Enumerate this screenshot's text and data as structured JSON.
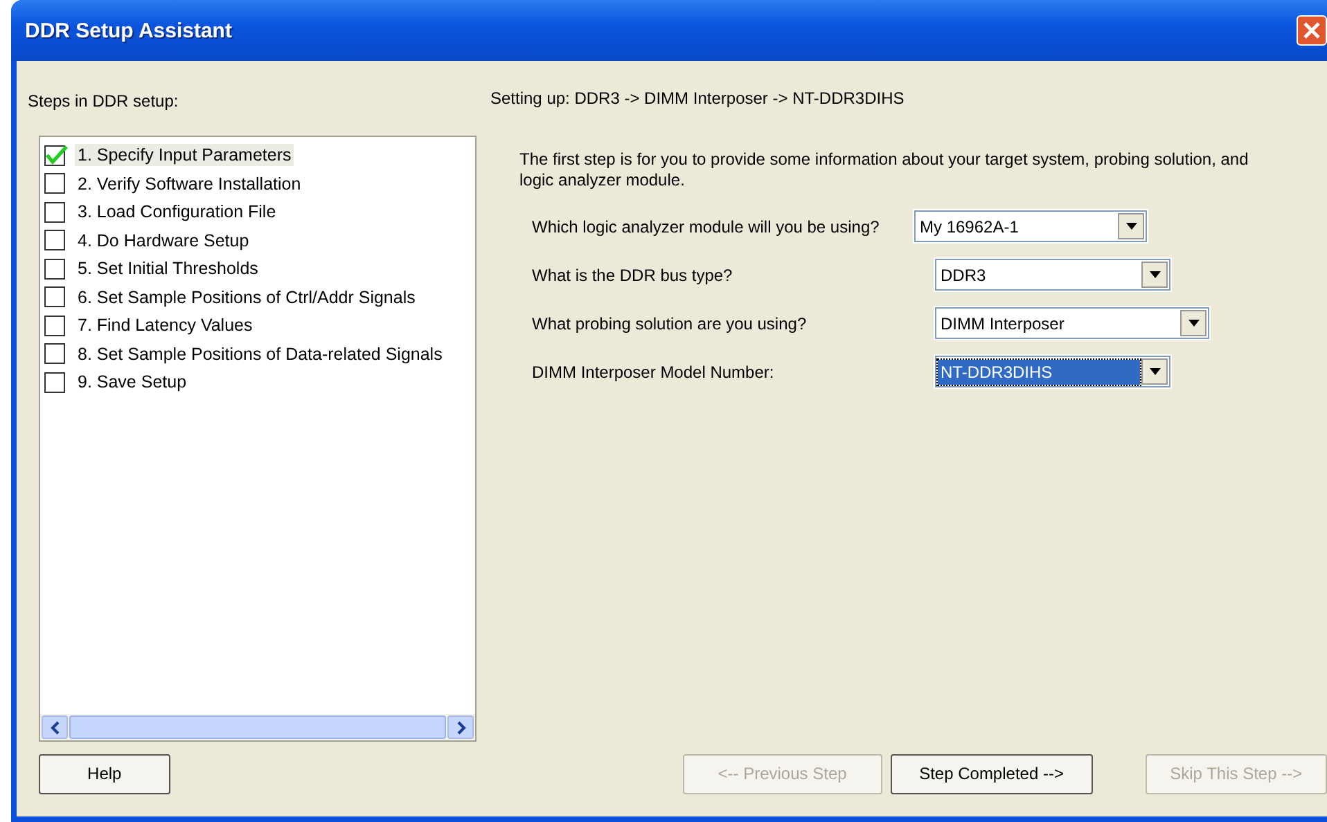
{
  "window": {
    "title": "DDR Setup Assistant"
  },
  "steps_label": "Steps in DDR setup:",
  "steps": [
    {
      "label": "1. Specify Input Parameters",
      "checked": true,
      "selected": true
    },
    {
      "label": "2. Verify Software Installation",
      "checked": false,
      "selected": false
    },
    {
      "label": "3. Load Configuration File",
      "checked": false,
      "selected": false
    },
    {
      "label": "4. Do Hardware Setup",
      "checked": false,
      "selected": false
    },
    {
      "label": "5. Set Initial Thresholds",
      "checked": false,
      "selected": false
    },
    {
      "label": "6. Set Sample Positions of Ctrl/Addr Signals",
      "checked": false,
      "selected": false
    },
    {
      "label": "7. Find Latency Values",
      "checked": false,
      "selected": false
    },
    {
      "label": "8. Set Sample Positions of Data-related Signals",
      "checked": false,
      "selected": false
    },
    {
      "label": "9. Save Setup",
      "checked": false,
      "selected": false
    }
  ],
  "setting_up": "Setting up: DDR3 -> DIMM Interposer -> NT-DDR3DIHS",
  "intro": "The first step is for you to provide some information about your target system, probing solution, and logic analyzer module.",
  "fields": [
    {
      "label": "Which logic analyzer module will you be using?",
      "value": "My 16962A-1",
      "focused": false
    },
    {
      "label": "What is the DDR bus type?",
      "value": "DDR3",
      "focused": false
    },
    {
      "label": "What probing solution are you using?",
      "value": "DIMM Interposer",
      "focused": false
    },
    {
      "label": "DIMM Interposer Model Number:",
      "value": "NT-DDR3DIHS",
      "focused": true
    }
  ],
  "buttons": [
    {
      "label": "Help",
      "disabled": false
    },
    {
      "label": "<-- Previous Step",
      "disabled": true
    },
    {
      "label": "Step Completed -->",
      "disabled": false
    },
    {
      "label": "Skip This Step -->",
      "disabled": true
    }
  ]
}
